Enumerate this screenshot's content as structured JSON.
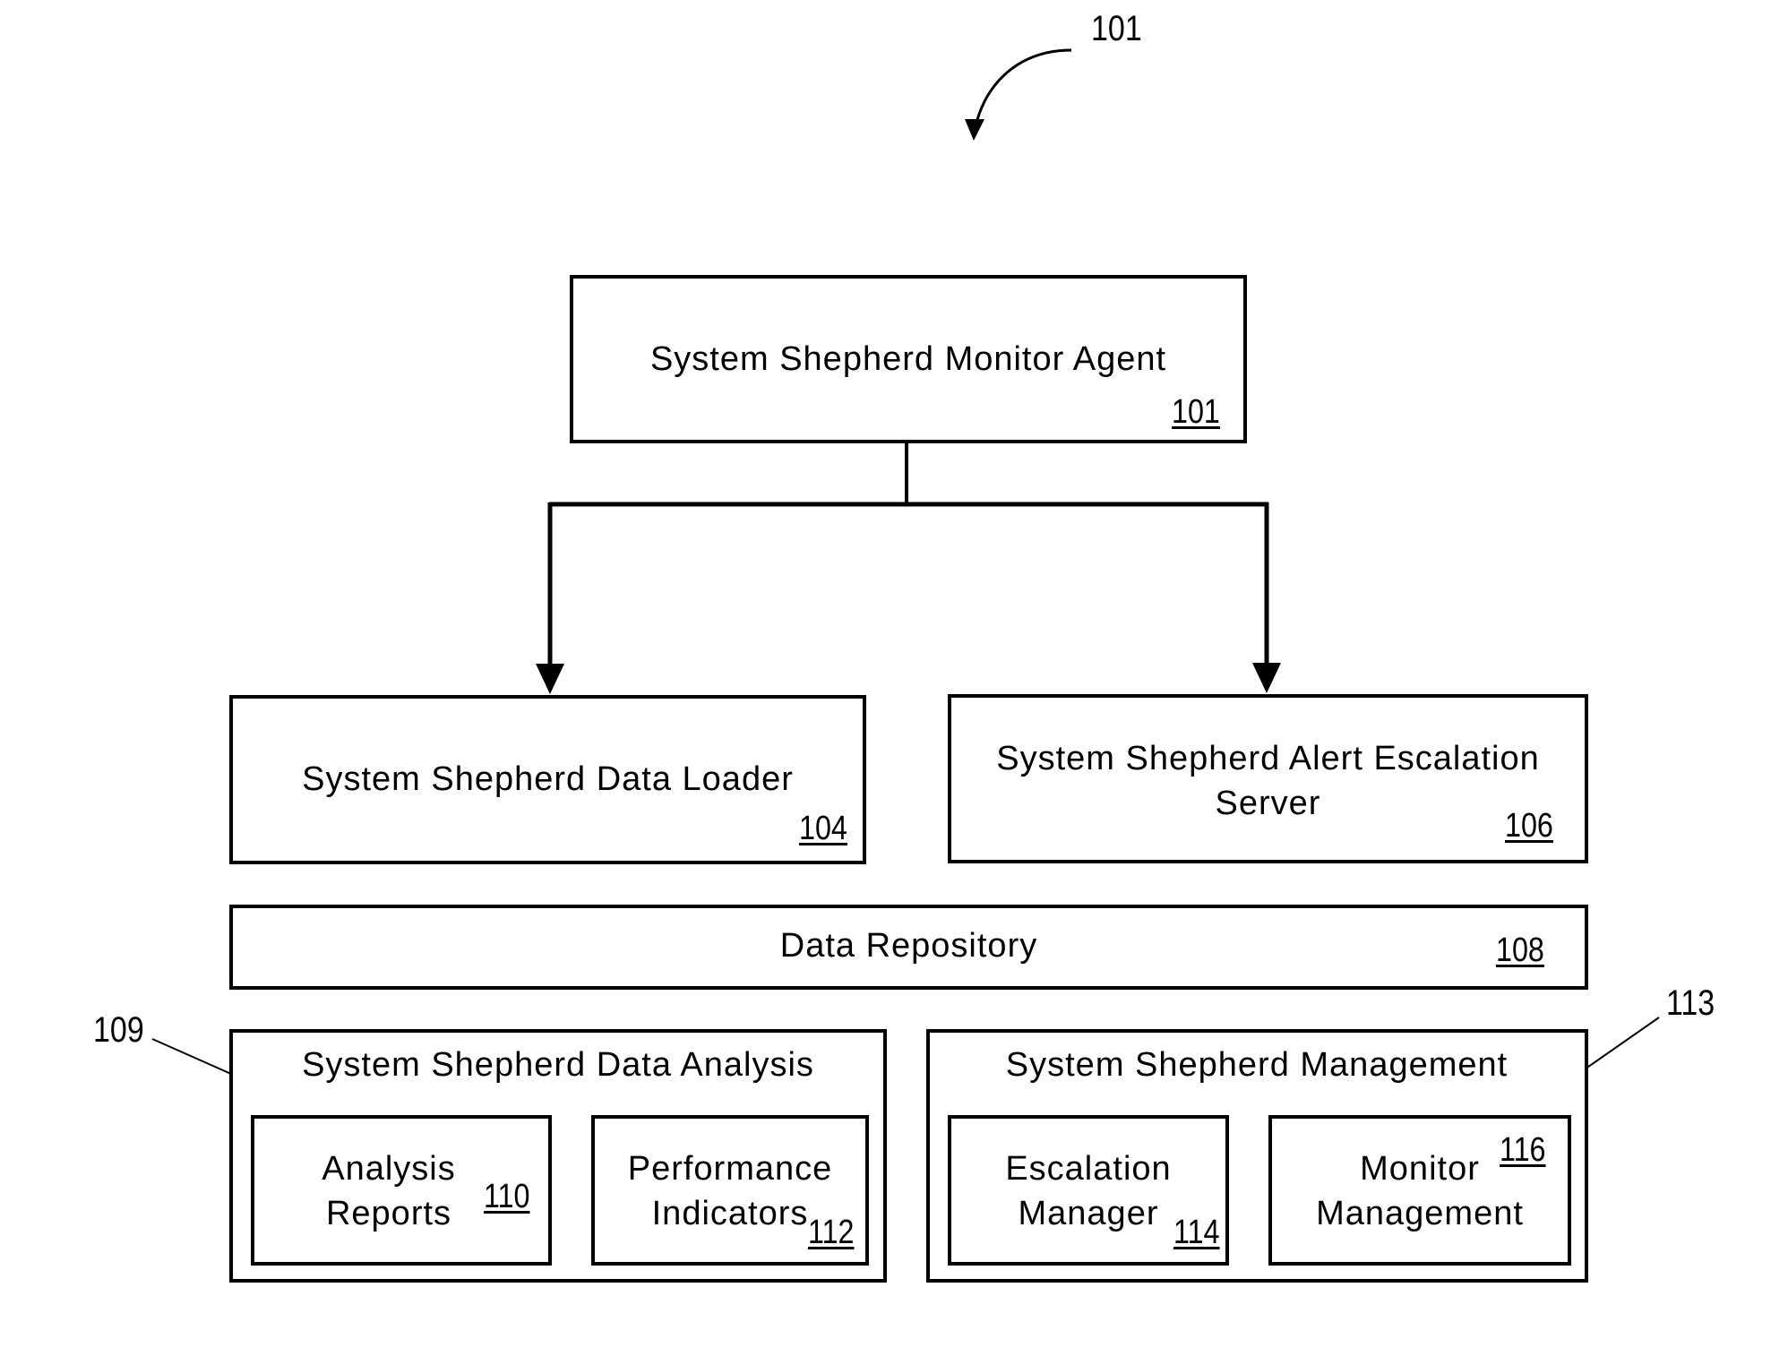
{
  "figure": {
    "callout_main": "101",
    "nodes": {
      "monitor_agent": {
        "label": "System Shepherd Monitor Agent",
        "ref": "101"
      },
      "data_loader": {
        "label": "System Shepherd Data Loader",
        "ref": "104"
      },
      "alert_server": {
        "label_line1": "System Shepherd Alert Escalation",
        "label_line2": "Server",
        "ref": "106"
      },
      "data_repository": {
        "label": "Data Repository",
        "ref": "108"
      },
      "data_analysis": {
        "label": "System Shepherd Data Analysis",
        "callout": "109",
        "children": {
          "analysis_reports": {
            "label_line1": "Analysis",
            "label_line2": "Reports",
            "ref": "110"
          },
          "performance_indicators": {
            "label_line1": "Performance",
            "label_line2": "Indicators",
            "ref": "112"
          }
        }
      },
      "management": {
        "label": "System Shepherd Management",
        "callout": "113",
        "children": {
          "escalation_manager": {
            "label_line1": "Escalation",
            "label_line2": "Manager",
            "ref": "114"
          },
          "monitor_management": {
            "label_line1": "Monitor",
            "label_line2": "Management",
            "ref": "116"
          }
        }
      }
    },
    "edges": [
      {
        "from": "monitor_agent",
        "to": "data_loader"
      },
      {
        "from": "monitor_agent",
        "to": "alert_server"
      }
    ]
  }
}
